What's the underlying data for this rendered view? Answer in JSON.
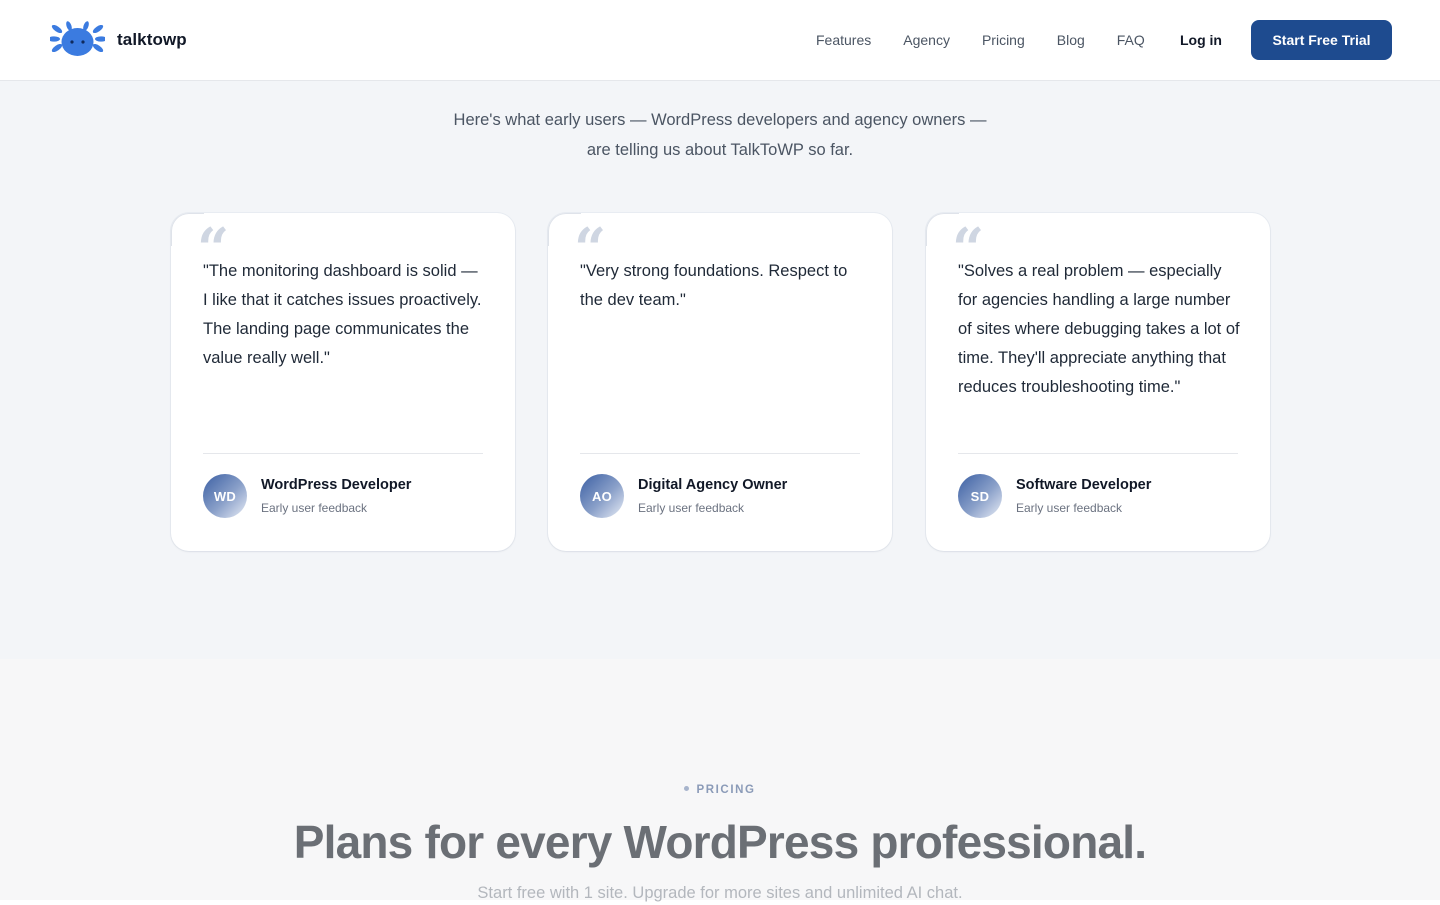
{
  "brand": {
    "name": "talktowp",
    "accent": "#1e4b8f",
    "logo_color": "#3b7be0"
  },
  "nav": {
    "links": [
      "Features",
      "Agency",
      "Pricing",
      "Blog",
      "FAQ"
    ],
    "login": "Log in",
    "cta": "Start Free Trial"
  },
  "testimonials": {
    "subtitle_line1": "Here's what early users — WordPress developers and agency owners —",
    "subtitle_line2": "are telling us about TalkToWP so far.",
    "quote_glyph": "“",
    "cards": [
      {
        "quote": "\"The monitoring dashboard is solid — I like that it catches issues proactively. The landing page communicates the value really well.\"",
        "initials": "WD",
        "author": "WordPress Developer",
        "source": "Early user feedback"
      },
      {
        "quote": "\"Very strong foundations. Respect to the dev team.\"",
        "initials": "AO",
        "author": "Digital Agency Owner",
        "source": "Early user feedback"
      },
      {
        "quote": "\"Solves a real problem — especially for agencies handling a large number of sites where debugging takes a lot of time. They'll appreciate anything that reduces troubleshooting time.\"",
        "initials": "SD",
        "author": "Software Developer",
        "source": "Early user feedback"
      }
    ]
  },
  "pricing": {
    "eyebrow": "PRICING",
    "title": "Plans for every WordPress professional.",
    "subtitle": "Start free with 1 site. Upgrade for more sites and unlimited AI chat."
  }
}
